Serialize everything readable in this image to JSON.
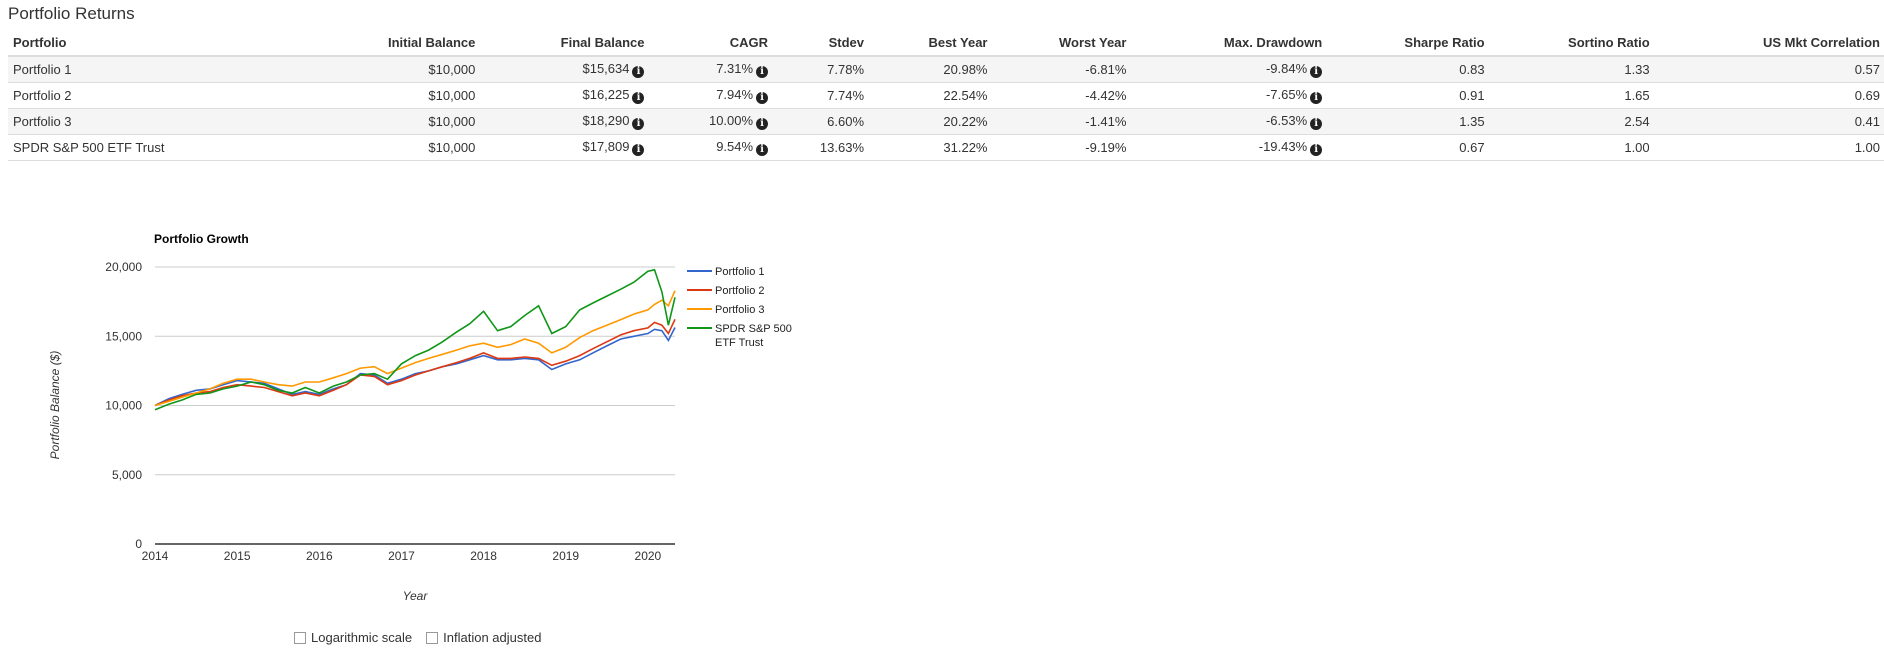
{
  "section_title": "Portfolio Returns",
  "table": {
    "headers": [
      "Portfolio",
      "Initial Balance",
      "Final Balance",
      "CAGR",
      "Stdev",
      "Best Year",
      "Worst Year",
      "Max. Drawdown",
      "Sharpe Ratio",
      "Sortino Ratio",
      "US Mkt Correlation"
    ],
    "rows": [
      {
        "name": "Portfolio 1",
        "initial": "$10,000",
        "final": "$15,634",
        "cagr": "7.31%",
        "stdev": "7.78%",
        "best": "20.98%",
        "worst": "-6.81%",
        "drawdown": "-9.84%",
        "sharpe": "0.83",
        "sortino": "1.33",
        "corr": "0.57"
      },
      {
        "name": "Portfolio 2",
        "initial": "$10,000",
        "final": "$16,225",
        "cagr": "7.94%",
        "stdev": "7.74%",
        "best": "22.54%",
        "worst": "-4.42%",
        "drawdown": "-7.65%",
        "sharpe": "0.91",
        "sortino": "1.65",
        "corr": "0.69"
      },
      {
        "name": "Portfolio 3",
        "initial": "$10,000",
        "final": "$18,290",
        "cagr": "10.00%",
        "stdev": "6.60%",
        "best": "20.22%",
        "worst": "-1.41%",
        "drawdown": "-6.53%",
        "sharpe": "1.35",
        "sortino": "2.54",
        "corr": "0.41"
      },
      {
        "name": "SPDR S&P 500 ETF Trust",
        "initial": "$10,000",
        "final": "$17,809",
        "cagr": "9.54%",
        "stdev": "13.63%",
        "best": "31.22%",
        "worst": "-9.19%",
        "drawdown": "-19.43%",
        "sharpe": "0.67",
        "sortino": "1.00",
        "corr": "1.00"
      }
    ]
  },
  "info_icon": "info-circle-icon",
  "options": {
    "log_label": "Logarithmic scale",
    "inflation_label": "Inflation adjusted",
    "log_checked": false,
    "inflation_checked": false
  },
  "chart_data": {
    "type": "line",
    "title": "Portfolio Growth",
    "xlabel": "Year",
    "ylabel": "Portfolio Balance ($)",
    "xlim": [
      2014,
      2020.33
    ],
    "ylim": [
      0,
      20000
    ],
    "x_ticks": [
      2014,
      2015,
      2016,
      2017,
      2018,
      2019,
      2020
    ],
    "y_ticks": [
      0,
      5000,
      10000,
      15000,
      20000
    ],
    "y_tick_labels": [
      "0",
      "5,000",
      "10,000",
      "15,000",
      "20,000"
    ],
    "grid": true,
    "legend_position": "right",
    "x": [
      2014.0,
      2014.17,
      2014.33,
      2014.5,
      2014.67,
      2014.83,
      2015.0,
      2015.17,
      2015.33,
      2015.5,
      2015.67,
      2015.83,
      2016.0,
      2016.17,
      2016.33,
      2016.5,
      2016.67,
      2016.83,
      2017.0,
      2017.17,
      2017.33,
      2017.5,
      2017.67,
      2017.83,
      2018.0,
      2018.17,
      2018.33,
      2018.5,
      2018.67,
      2018.83,
      2019.0,
      2019.17,
      2019.33,
      2019.5,
      2019.67,
      2019.83,
      2020.0,
      2020.08,
      2020.17,
      2020.25,
      2020.33
    ],
    "series": [
      {
        "name": "Portfolio 1",
        "color": "#3366cc",
        "values": [
          10000,
          10500,
          10800,
          11100,
          11200,
          11500,
          11800,
          11700,
          11600,
          11200,
          10800,
          11000,
          10800,
          11200,
          11500,
          12300,
          12200,
          11600,
          11900,
          12300,
          12500,
          12800,
          13000,
          13300,
          13600,
          13300,
          13300,
          13400,
          13300,
          12600,
          13000,
          13300,
          13800,
          14300,
          14800,
          15000,
          15200,
          15500,
          15400,
          14700,
          15634
        ]
      },
      {
        "name": "Portfolio 2",
        "color": "#dc3912",
        "values": [
          10000,
          10400,
          10700,
          10900,
          11000,
          11300,
          11500,
          11400,
          11300,
          11000,
          10700,
          10900,
          10700,
          11100,
          11500,
          12200,
          12100,
          11500,
          11800,
          12200,
          12500,
          12800,
          13100,
          13400,
          13800,
          13400,
          13400,
          13500,
          13400,
          12900,
          13200,
          13600,
          14100,
          14600,
          15100,
          15400,
          15600,
          16000,
          15800,
          15200,
          16225
        ]
      },
      {
        "name": "Portfolio 3",
        "color": "#ff9900",
        "values": [
          10000,
          10300,
          10600,
          10900,
          11200,
          11600,
          11900,
          11900,
          11700,
          11500,
          11400,
          11700,
          11700,
          12000,
          12300,
          12700,
          12800,
          12300,
          12700,
          13100,
          13400,
          13700,
          14000,
          14300,
          14500,
          14200,
          14400,
          14800,
          14500,
          13800,
          14200,
          14900,
          15400,
          15800,
          16200,
          16600,
          16900,
          17300,
          17600,
          17200,
          18290
        ]
      },
      {
        "name": "SPDR S&P 500 ETF Trust",
        "color": "#109618",
        "values": [
          9700,
          10100,
          10400,
          10800,
          10900,
          11200,
          11400,
          11700,
          11500,
          11100,
          10900,
          11300,
          10900,
          11400,
          11700,
          12200,
          12300,
          11900,
          13000,
          13600,
          14000,
          14600,
          15300,
          15900,
          16800,
          15400,
          15700,
          16500,
          17200,
          15200,
          15700,
          16900,
          17400,
          17900,
          18400,
          18900,
          19700,
          19800,
          18200,
          15800,
          17809
        ]
      }
    ],
    "legend_lines": {
      "series_4_line1": "SPDR S&P 500",
      "series_4_line2": "ETF Trust"
    }
  }
}
